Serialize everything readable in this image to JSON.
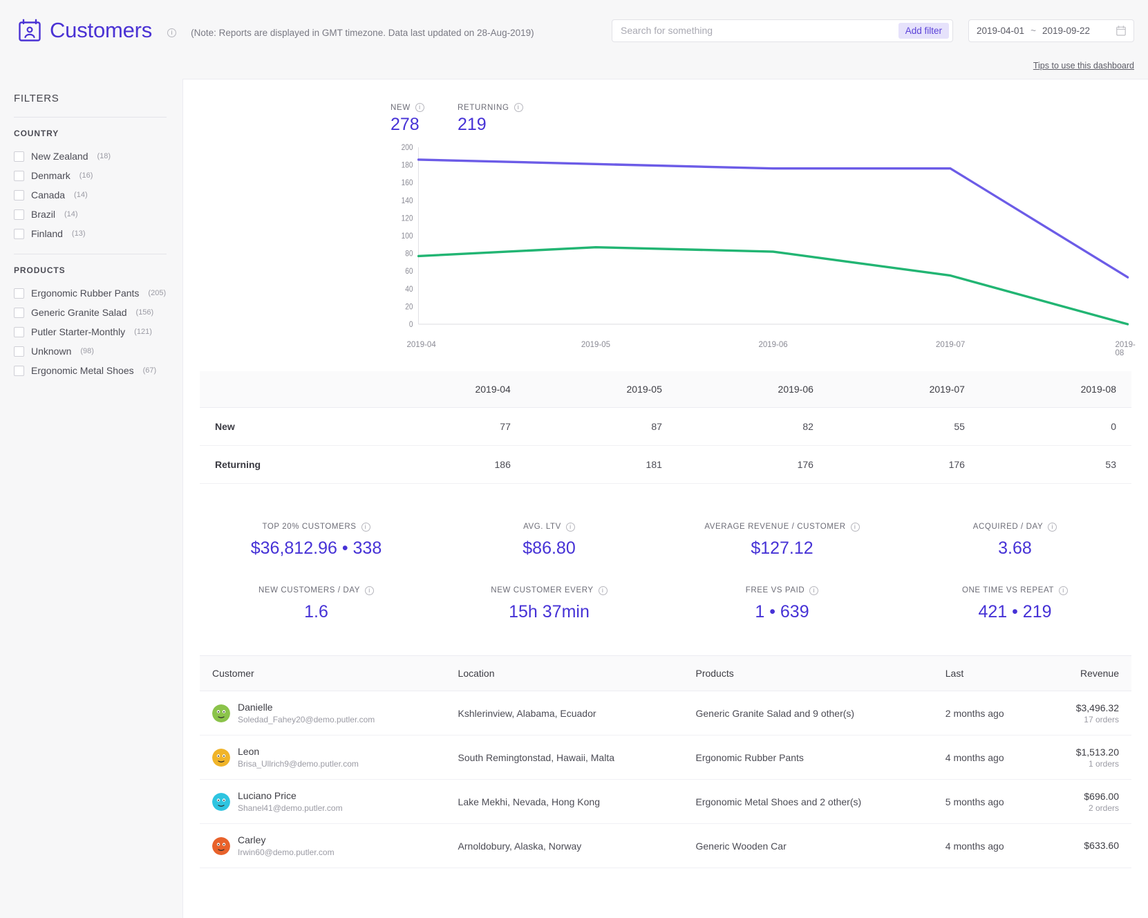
{
  "header": {
    "title": "Customers",
    "note": "(Note: Reports are displayed in GMT timezone. Data last updated on 28-Aug-2019)",
    "search_placeholder": "Search for something",
    "search_value": "",
    "add_filter_label": "Add filter",
    "date_start": "2019-04-01",
    "date_separator": "~",
    "date_end": "2019-09-22",
    "tips_link": "Tips to use this dashboard"
  },
  "sidebar": {
    "heading": "FILTERS",
    "facets": [
      {
        "title": "COUNTRY",
        "items": [
          {
            "label": "New Zealand",
            "count": "(18)"
          },
          {
            "label": "Denmark",
            "count": "(16)"
          },
          {
            "label": "Canada",
            "count": "(14)"
          },
          {
            "label": "Brazil",
            "count": "(14)"
          },
          {
            "label": "Finland",
            "count": "(13)"
          }
        ]
      },
      {
        "title": "PRODUCTS",
        "items": [
          {
            "label": "Ergonomic Rubber Pants",
            "count": "(205)"
          },
          {
            "label": "Generic Granite Salad",
            "count": "(156)"
          },
          {
            "label": "Putler Starter-Monthly",
            "count": "(121)"
          },
          {
            "label": "Unknown",
            "count": "(98)"
          },
          {
            "label": "Ergonomic Metal Shoes",
            "count": "(67)"
          }
        ]
      }
    ]
  },
  "chart_header": {
    "new_label": "NEW",
    "new_value": "278",
    "returning_label": "RETURNING",
    "returning_value": "219"
  },
  "chart_data": {
    "type": "line",
    "title": "",
    "xlabel": "",
    "ylabel": "",
    "x": [
      "2019-04",
      "2019-05",
      "2019-06",
      "2019-07",
      "2019-08"
    ],
    "ylim": [
      0,
      200
    ],
    "yticks": [
      0,
      20,
      40,
      60,
      80,
      100,
      120,
      140,
      160,
      180,
      200
    ],
    "grid": false,
    "legend": "top-left",
    "series": [
      {
        "name": "Returning",
        "color": "#6c5ce7",
        "values": [
          186,
          181,
          176,
          176,
          53
        ]
      },
      {
        "name": "New",
        "color": "#22b573",
        "values": [
          77,
          87,
          82,
          55,
          0
        ]
      }
    ]
  },
  "month_table": {
    "columns": [
      "",
      "2019-04",
      "2019-05",
      "2019-06",
      "2019-07",
      "2019-08"
    ],
    "rows": [
      {
        "label": "New",
        "values": [
          "77",
          "87",
          "82",
          "55",
          "0"
        ]
      },
      {
        "label": "Returning",
        "values": [
          "186",
          "181",
          "176",
          "176",
          "53"
        ]
      }
    ]
  },
  "kpis": [
    {
      "label": "TOP 20% CUSTOMERS",
      "value": "$36,812.96 • 338"
    },
    {
      "label": "AVG. LTV",
      "value": "$86.80"
    },
    {
      "label": "AVERAGE REVENUE / CUSTOMER",
      "value": "$127.12"
    },
    {
      "label": "ACQUIRED / DAY",
      "value": "3.68"
    },
    {
      "label": "NEW CUSTOMERS / DAY",
      "value": "1.6"
    },
    {
      "label": "NEW CUSTOMER EVERY",
      "value": "15h 37min"
    },
    {
      "label": "FREE VS PAID",
      "value": "1 • 639"
    },
    {
      "label": "ONE TIME VS REPEAT",
      "value": "421 • 219"
    }
  ],
  "customers_table": {
    "columns": [
      "Customer",
      "Location",
      "Products",
      "Last",
      "Revenue"
    ],
    "rows": [
      {
        "name": "Danielle",
        "email": "Soledad_Fahey20@demo.putler.com",
        "avatar_color": "#8bc34a",
        "location": "Kshlerinview, Alabama, Ecuador",
        "products": "Generic Granite Salad and 9 other(s)",
        "last": "2 months ago",
        "revenue": "$3,496.32",
        "orders": "17 orders"
      },
      {
        "name": "Leon",
        "email": "Brisa_Ullrich9@demo.putler.com",
        "avatar_color": "#f0b429",
        "location": "South Remingtonstad, Hawaii, Malta",
        "products": "Ergonomic Rubber Pants",
        "last": "4 months ago",
        "revenue": "$1,513.20",
        "orders": "1 orders"
      },
      {
        "name": "Luciano Price",
        "email": "Shanel41@demo.putler.com",
        "avatar_color": "#2ec4e0",
        "location": "Lake Mekhi, Nevada, Hong Kong",
        "products": "Ergonomic Metal Shoes and 2 other(s)",
        "last": "5 months ago",
        "revenue": "$696.00",
        "orders": "2 orders"
      },
      {
        "name": "Carley",
        "email": "Irwin60@demo.putler.com",
        "avatar_color": "#e8622b",
        "location": "Arnoldobury, Alaska, Norway",
        "products": "Generic Wooden Car",
        "last": "4 months ago",
        "revenue": "$633.60",
        "orders": ""
      }
    ]
  }
}
